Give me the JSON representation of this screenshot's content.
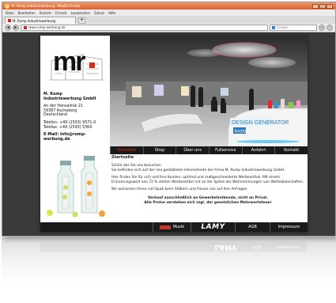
{
  "browser": {
    "title": "M. Rump Industriewerbung - Mozilla Firefox",
    "menu": [
      "Datei",
      "Bearbeiten",
      "Ansicht",
      "Chronik",
      "Lesezeichen",
      "Extras",
      "Hilfe"
    ],
    "tab_label": "M. Rump Industriewerbung",
    "new_tab": "+",
    "url": "www.rump-werbung.de",
    "search_placeholder": "Google"
  },
  "company": {
    "name_line1": "M. Rump",
    "name_line2": "Industriewerbung GmbH",
    "street": "An der Hansalinie 21",
    "city": "59387 Ascheberg",
    "country": "Deutschland",
    "phone": "Telefon: +49 (2593) 9571-0",
    "fax": "Telefax: +49 (2593) 5369",
    "email": "E-Mail: info@rump-werbung.de"
  },
  "nav": [
    "Startseite",
    "Shop",
    "Über uns",
    "Fullservice",
    "Anfahrt",
    "Kontakt"
  ],
  "content": {
    "heading": "Startseite",
    "greeting": "Schön das Sie uns besuchen.",
    "intro": "Sie befinden sich auf der neu gestalteten Internetseite der Firma M. Rump Industriewerbung GmbH.",
    "service": "Hier finden Sie für sich und Ihre Kunden, optimal und maßgeschneiderte Werbeartikel. Mit einem Erinnerungswert von 72 % stehen Werbeartikel mit an der Spitze der Wahrnehmungen von Werbebotschaften.",
    "wish": "Wir wünschen Ihnen viel Spaß beim Stöbern und freuen uns auf Ihre Anfragen.",
    "notice1": "Verkauf ausschließlich an Gewerbetreibende, nicht an Privat.",
    "notice2": "Alle Preise verstehen sich zzgl. der gesetzlichen Mehrwertsteuer"
  },
  "hero": {
    "sign1": "DESIGN GENERATOR",
    "sign2": "koziol"
  },
  "footer": {
    "musik": "Musik",
    "lamy": "LAMY",
    "agb": "AGB",
    "impressum": "Impressum"
  },
  "colors": {
    "accent": "#d62a1a",
    "bar": "#1a1a1a",
    "backdrop": "#3a3a3a"
  }
}
